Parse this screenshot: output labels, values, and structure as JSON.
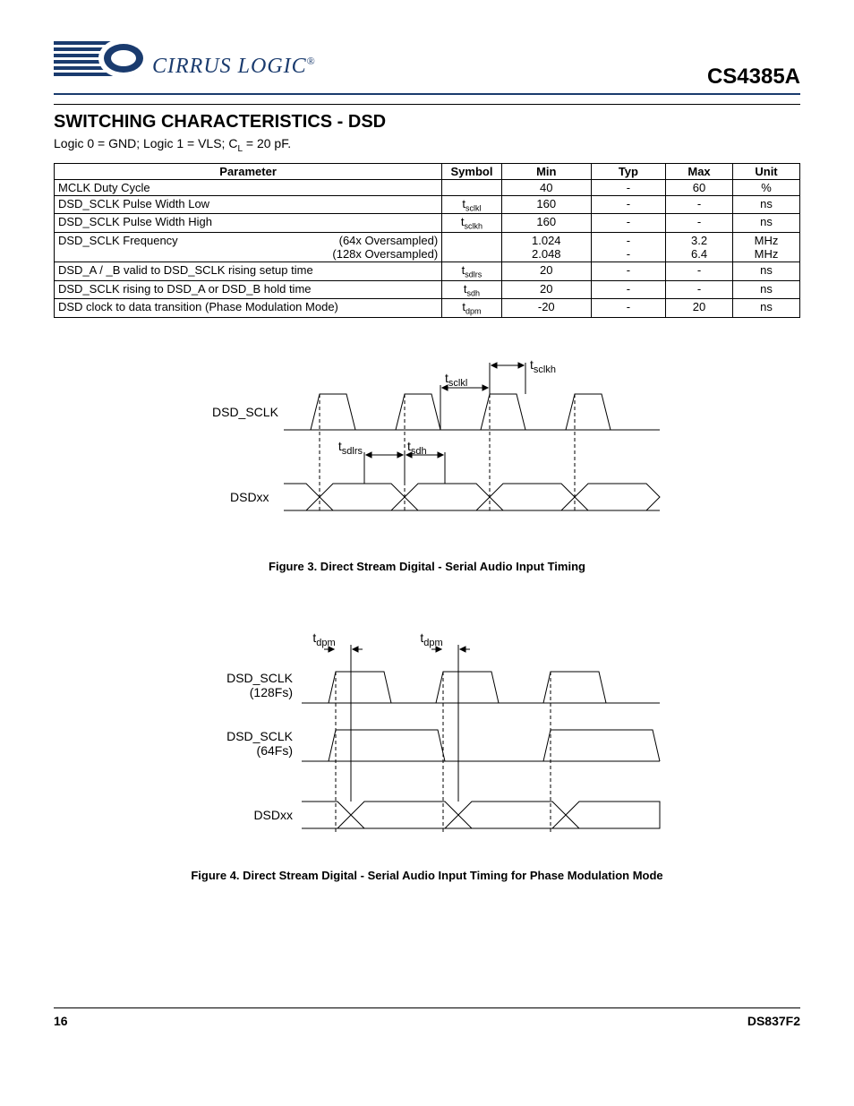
{
  "header": {
    "logo_text": "CIRRUS LOGIC",
    "part_number": "CS4385A"
  },
  "section_title": "SWITCHING CHARACTERISTICS - DSD",
  "conditions_prefix": "Logic 0 = GND; Logic 1 = VLS; C",
  "conditions_sub": "L",
  "conditions_suffix": " = 20 pF.",
  "table": {
    "headers": [
      "Parameter",
      "Symbol",
      "Min",
      "Typ",
      "Max",
      "Unit"
    ],
    "rows": [
      {
        "param": "MCLK Duty Cycle",
        "param_right": "",
        "symbol": "",
        "min": "40",
        "typ": "-",
        "max": "60",
        "unit": "%"
      },
      {
        "param": "DSD_SCLK Pulse Width Low",
        "param_right": "",
        "symbol_base": "t",
        "symbol_sub": "sclkl",
        "min": "160",
        "typ": "-",
        "max": "-",
        "unit": "ns"
      },
      {
        "param": "DSD_SCLK Pulse Width High",
        "param_right": "",
        "symbol_base": "t",
        "symbol_sub": "sclkh",
        "min": "160",
        "typ": "-",
        "max": "-",
        "unit": "ns"
      },
      {
        "param": "DSD_SCLK Frequency",
        "param_right": "(64x Oversampled)\n(128x Oversampled)",
        "symbol": "",
        "min": "1.024\n2.048",
        "typ": "-\n-",
        "max": "3.2\n6.4",
        "unit": "MHz\nMHz"
      },
      {
        "param": "DSD_A / _B valid to DSD_SCLK rising setup time",
        "param_right": "",
        "symbol_base": "t",
        "symbol_sub": "sdlrs",
        "min": "20",
        "typ": "-",
        "max": "-",
        "unit": "ns"
      },
      {
        "param": "DSD_SCLK rising to DSD_A or DSD_B hold time",
        "param_right": "",
        "symbol_base": "t",
        "symbol_sub": "sdh",
        "min": "20",
        "typ": "-",
        "max": "-",
        "unit": "ns"
      },
      {
        "param": "DSD clock to data transition (Phase Modulation Mode)",
        "param_right": "",
        "symbol_base": "t",
        "symbol_sub": "dpm",
        "min": "-20",
        "typ": "-",
        "max": "20",
        "unit": "ns"
      }
    ]
  },
  "figure3": {
    "labels": {
      "t_sclkh": "sclkh",
      "t_sclkl": "sclkl",
      "t_sdlrs": "sdlrs",
      "t_sdh": "sdh",
      "dsd_sclk": "DSD_SCLK",
      "dsdxx": "DSDxx"
    },
    "caption": "Figure 3.  Direct Stream Digital - Serial Audio Input Timing"
  },
  "figure4": {
    "labels": {
      "t_dpm": "dpm",
      "dsd_sclk_128": "DSD_SCLK",
      "dsd_sclk_128_sub": "(128Fs)",
      "dsd_sclk_64": "DSD_SCLK",
      "dsd_sclk_64_sub": "(64Fs)",
      "dsdxx": "DSDxx"
    },
    "caption": "Figure 4.  Direct Stream Digital - Serial Audio Input Timing for Phase Modulation Mode"
  },
  "footer": {
    "page": "16",
    "doc": "DS837F2"
  }
}
